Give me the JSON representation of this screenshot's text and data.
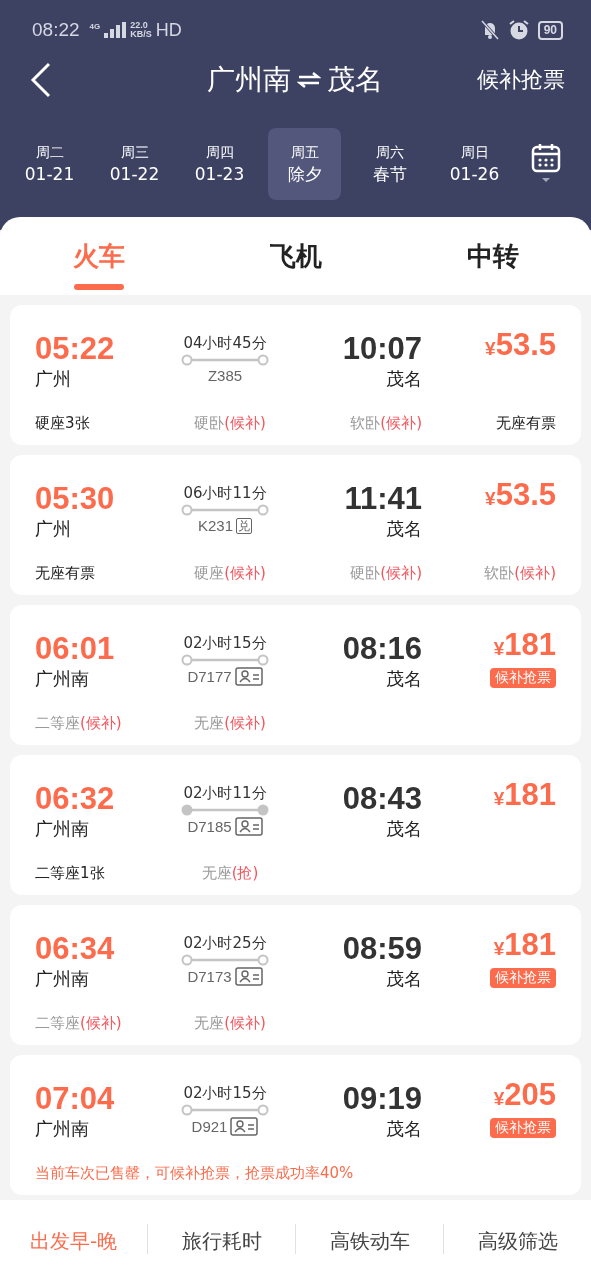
{
  "status_bar": {
    "time": "08:22",
    "network": "4G",
    "speed_value": "22.0",
    "speed_unit": "KB/S",
    "hd": "HD",
    "battery": "90"
  },
  "header": {
    "from": "广州南",
    "to": "茂名",
    "action": "候补抢票"
  },
  "dates": [
    {
      "weekday": "周二",
      "label": "01-21",
      "selected": false
    },
    {
      "weekday": "周三",
      "label": "01-22",
      "selected": false
    },
    {
      "weekday": "周四",
      "label": "01-23",
      "selected": false
    },
    {
      "weekday": "周五",
      "label": "除夕",
      "selected": true
    },
    {
      "weekday": "周六",
      "label": "春节",
      "selected": false
    },
    {
      "weekday": "周日",
      "label": "01-26",
      "selected": false
    }
  ],
  "tabs": [
    {
      "label": "火车",
      "selected": true
    },
    {
      "label": "飞机",
      "selected": false
    },
    {
      "label": "中转",
      "selected": false
    }
  ],
  "trains": [
    {
      "depart": "05:22",
      "from": "广州",
      "duration": "04小时45分",
      "dots_filled": false,
      "number": "Z385",
      "arrive": "10:07",
      "to": "茂名",
      "price": "53.5",
      "currency": "¥",
      "seats": [
        {
          "name": "硬座3张",
          "available": true
        },
        {
          "name": "硬卧",
          "status": "(候补)",
          "available": false
        },
        {
          "name": "软卧",
          "status": "(候补)",
          "available": false
        },
        {
          "name": "无座有票",
          "available": true
        }
      ]
    },
    {
      "depart": "05:30",
      "from": "广州",
      "duration": "06小时11分",
      "dots_filled": false,
      "number": "K231",
      "tag": "兑",
      "arrive": "11:41",
      "to": "茂名",
      "price": "53.5",
      "currency": "¥",
      "seats": [
        {
          "name": "无座有票",
          "available": true
        },
        {
          "name": "硬座",
          "status": "(候补)",
          "available": false
        },
        {
          "name": "硬卧",
          "status": "(候补)",
          "available": false
        },
        {
          "name": "软卧",
          "status": "(候补)",
          "available": false
        }
      ]
    },
    {
      "depart": "06:01",
      "from": "广州南",
      "duration": "02小时15分",
      "dots_filled": false,
      "number": "D7177",
      "id_card": true,
      "arrive": "08:16",
      "to": "茂名",
      "price": "181",
      "currency": "¥",
      "waitlist": "候补抢票",
      "seats": [
        {
          "name": "二等座",
          "status": "(候补)",
          "available": false
        },
        {
          "name": "无座",
          "status": "(候补)",
          "available": false
        }
      ]
    },
    {
      "depart": "06:32",
      "from": "广州南",
      "duration": "02小时11分",
      "dots_filled": true,
      "number": "D7185",
      "id_card": true,
      "arrive": "08:43",
      "to": "茂名",
      "price": "181",
      "currency": "¥",
      "seats": [
        {
          "name": "二等座1张",
          "available": true
        },
        {
          "name": "无座",
          "status": "(抢)",
          "available": false
        }
      ]
    },
    {
      "depart": "06:34",
      "from": "广州南",
      "duration": "02小时25分",
      "dots_filled": false,
      "number": "D7173",
      "id_card": true,
      "arrive": "08:59",
      "to": "茂名",
      "price": "181",
      "currency": "¥",
      "waitlist": "候补抢票",
      "seats": [
        {
          "name": "二等座",
          "status": "(候补)",
          "available": false
        },
        {
          "name": "无座",
          "status": "(候补)",
          "available": false
        }
      ]
    },
    {
      "depart": "07:04",
      "from": "广州南",
      "duration": "02小时15分",
      "dots_filled": false,
      "number": "D921",
      "id_card": true,
      "arrive": "09:19",
      "to": "茂名",
      "price": "205",
      "currency": "¥",
      "waitlist": "候补抢票",
      "note": "当前车次已售罄，可候补抢票，抢票成功率40%"
    }
  ],
  "sort_bar": [
    {
      "label": "出发早-晚",
      "selected": true
    },
    {
      "label": "旅行耗时",
      "selected": false
    },
    {
      "label": "高铁动车",
      "selected": false
    },
    {
      "label": "高级筛选",
      "selected": false
    }
  ]
}
